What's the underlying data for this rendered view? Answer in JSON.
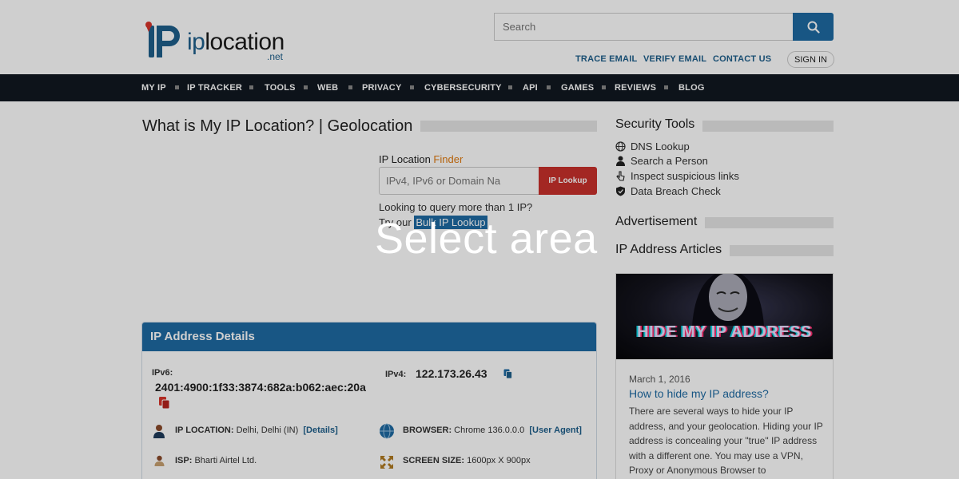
{
  "header": {
    "logo": {
      "ip": "ip",
      "location": "location",
      "net": ".net"
    },
    "search": {
      "placeholder": "Search"
    },
    "links": [
      "TRACE EMAIL",
      "VERIFY EMAIL",
      "CONTACT US"
    ],
    "signin_label": "SIGN IN"
  },
  "nav": {
    "items": [
      "MY IP",
      "IP TRACKER",
      "TOOLS",
      "WEB",
      "PRIVACY",
      "CYBERSECURITY",
      "API",
      "GAMES",
      "REVIEWS",
      "BLOG"
    ]
  },
  "main": {
    "title": "What is My IP Location? | Geolocation",
    "finder": {
      "label_prefix": "IP Location ",
      "label_accent": "Finder",
      "placeholder": "IPv4, IPv6 or Domain Na",
      "button_label": "IP Lookup",
      "query_text": "Looking to query more than 1 IP?",
      "try_prefix": "Try our ",
      "bulk_link": "Bulk IP Lookup"
    }
  },
  "details": {
    "heading": "IP Address Details",
    "ipv6_label": "IPv6:",
    "ipv6_value": "2401:4900:1f33:3874:682a:b062:aec:20a",
    "ipv4_label": "IPv4:",
    "ipv4_value": "122.173.26.43",
    "location_label": "IP LOCATION:",
    "location_value": "Delhi, Delhi (IN)",
    "location_link": "[Details]",
    "browser_label": "BROWSER:",
    "browser_value": "Chrome 136.0.0.0",
    "browser_link": "[User Agent]",
    "isp_label": "ISP:",
    "isp_value": "Bharti Airtel Ltd.",
    "screen_label": "SCREEN SIZE:",
    "screen_value": "1600px X 900px"
  },
  "sidebar": {
    "security_title": "Security Tools",
    "tools": [
      "DNS Lookup",
      "Search a Person",
      "Inspect suspicious links",
      "Data Breach Check"
    ],
    "advertisement_title": "Advertisement",
    "articles_title": "IP Address Articles",
    "article": {
      "image_text": "HIDE MY IP ADDRESS",
      "date": "March 1, 2016",
      "title": "How to hide my IP address?",
      "body": "There are several ways to hide your IP address, and your geolocation. Hiding your IP address is concealing your \"true\" IP address with a different one. You may use a VPN, Proxy or Anonymous Browser to"
    }
  },
  "overlay": {
    "text": "Select area"
  },
  "colors": {
    "accent": "#1e6aa3",
    "nav_bg": "#101820",
    "lookup_button": "#c9302c",
    "finder_accent": "#e07a10"
  }
}
